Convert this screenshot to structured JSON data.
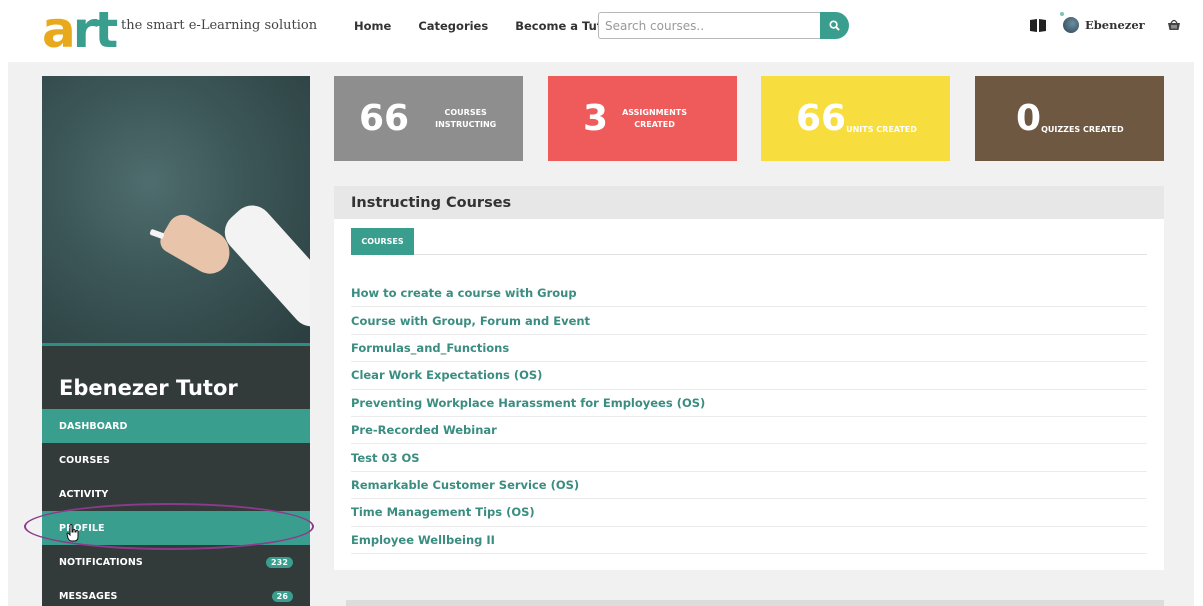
{
  "header": {
    "logo_a": "a",
    "logo_rt": "rt",
    "tagline": "the smart e-Learning solution",
    "nav": [
      "Home",
      "Categories",
      "Become a Tutor"
    ],
    "search_placeholder": "Search courses..",
    "username": "Ebenezer",
    "icons": [
      "search-icon",
      "book-icon",
      "avatar",
      "cart-icon"
    ]
  },
  "sidebar": {
    "tutor_name": "Ebenezer Tutor",
    "menu": [
      {
        "label": "DASHBOARD",
        "badge": null
      },
      {
        "label": "COURSES",
        "badge": null
      },
      {
        "label": "ACTIVITY",
        "badge": null
      },
      {
        "label": "PROFILE",
        "badge": null
      },
      {
        "label": "NOTIFICATIONS",
        "badge": "232"
      },
      {
        "label": "MESSAGES",
        "badge": "26"
      }
    ]
  },
  "stats": [
    {
      "number": "66",
      "label_line1": "COURSES",
      "label_line2": "INSTRUCTING",
      "color": "#8e8e8e"
    },
    {
      "number": "3",
      "label_line1": "ASSIGNMENTS",
      "label_line2": "CREATED",
      "color": "#ef5a5a"
    },
    {
      "number": "66",
      "label_line1": "UNITS CREATED",
      "label_line2": "",
      "color": "#f7dd3d"
    },
    {
      "number": "0",
      "label_line1": "QUIZZES CREATED",
      "label_line2": "",
      "color": "#6e5842"
    }
  ],
  "panel": {
    "title": "Instructing Courses",
    "tab": "COURSES",
    "courses": [
      "How to create a course with Group",
      "Course with Group, Forum and Event",
      "Formulas_and_Functions",
      "Clear Work Expectations (OS)",
      "Preventing Workplace Harassment for Employees (OS)",
      "Pre-Recorded Webinar",
      "Test 03 OS",
      "Remarkable Customer Service (OS)",
      "Time Management Tips (OS)",
      "Employee Wellbeing II"
    ]
  },
  "colors": {
    "accent": "#3a9e8e",
    "logo_orange": "#e8a91c",
    "sidebar_dark": "#333a3a",
    "annotation_oval": "#8d3a8c"
  }
}
